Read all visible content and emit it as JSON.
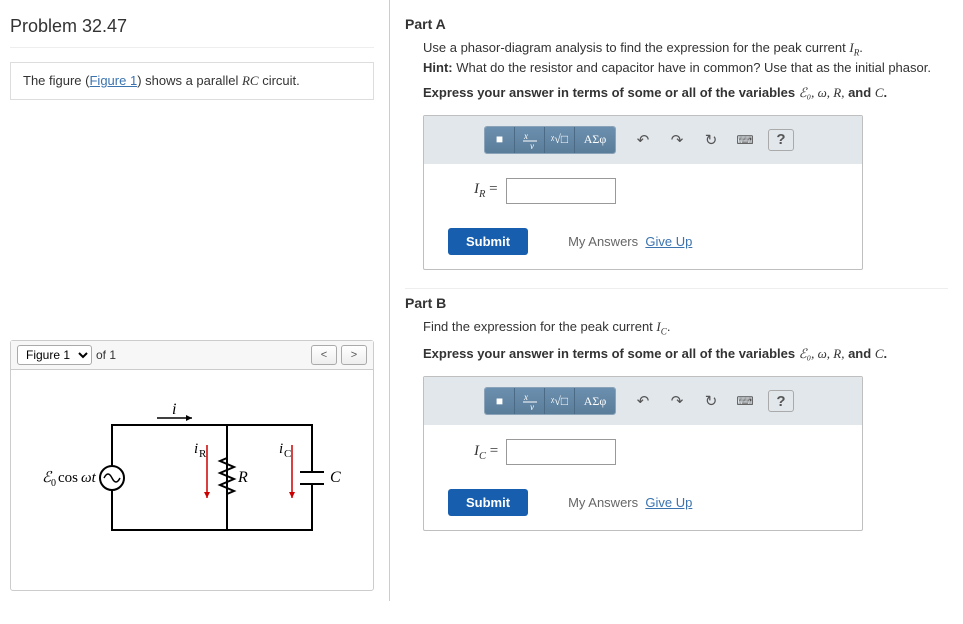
{
  "problem": {
    "title": "Problem 32.47"
  },
  "intro": {
    "prefix": "The figure (",
    "link": "Figure 1",
    "suffix": ") shows a parallel ",
    "circuit": "RC",
    "end": " circuit."
  },
  "figure": {
    "select_label": "Figure 1",
    "of_text": "of 1",
    "prev": "<",
    "next": ">",
    "labels": {
      "source": "ℰ₀cosωt",
      "i": "i",
      "iR": "iR",
      "R": "R",
      "iC": "iC",
      "C": "C"
    }
  },
  "parts": [
    {
      "label": "Part A",
      "lines": [
        "Use a phasor-diagram analysis to find the expression for the peak current ",
        "I",
        "R",
        "."
      ],
      "hint_label": "Hint:",
      "hint": " What do the resistor and capacitor have in common? Use that as the initial phasor.",
      "express_prefix": "Express your answer in terms of some or all of the variables ",
      "vars": "ℰ₀, ω, R,",
      "and": " and ",
      "lastvar": "C",
      "period": ".",
      "answer_label": "I",
      "answer_sub": "R",
      "equals": " = ",
      "submit": "Submit",
      "my_answers": "My Answers",
      "give_up": "Give Up"
    },
    {
      "label": "Part B",
      "lines": [
        "Find the expression for the peak current ",
        "I",
        "C",
        "."
      ],
      "express_prefix": "Express your answer in terms of some or all of the variables ",
      "vars": "ℰ₀, ω, R,",
      "and": " and ",
      "lastvar": "C",
      "period": ".",
      "answer_label": "I",
      "answer_sub": "C",
      "equals": " = ",
      "submit": "Submit",
      "my_answers": "My Answers",
      "give_up": "Give Up"
    }
  ],
  "toolbar": {
    "template": "■",
    "frac": "x/y",
    "root": "ᵡ√□",
    "greek": "ΑΣφ",
    "undo": "↶",
    "redo": "↷",
    "reset": "↻",
    "keyboard": "⌨",
    "help": "?"
  }
}
